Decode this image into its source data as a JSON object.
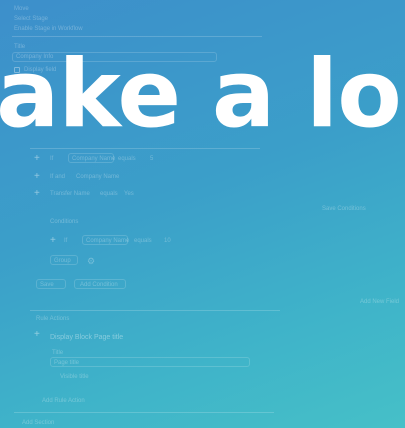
{
  "headline": "ake a lo",
  "background": {
    "top_color": "#3d8fcb",
    "bottom_color": "#46c0c8"
  },
  "ghost_ui": {
    "top_label": "Move",
    "top_sub": "Select Stage",
    "top_hint": "Enable Stage in Workflow",
    "section_label": "Title",
    "title_value": "Company Info",
    "display_label": "Display field",
    "rows": [
      {
        "op": "If",
        "a": "Company Name",
        "b": "equals",
        "c": "5"
      },
      {
        "op": "If and",
        "a": "Company Name",
        "b": "",
        "c": ""
      },
      {
        "op": "Transfer Name",
        "a": "equals",
        "b": "Yes",
        "c": ""
      }
    ],
    "right_note_1": "Save Conditions",
    "cond_group_label": "Conditions",
    "cond_row": {
      "op": "If",
      "a": "Company Name",
      "b": "equals",
      "c": "10"
    },
    "when_label": "Group",
    "bottom_add": "Add Condition",
    "bottom_when": "Save",
    "right_note_2": "Add New Field",
    "rule_header": "Rule Actions",
    "rule_title": "Display Block Page title",
    "rule_field_label": "Title",
    "rule_field_value": "Page title",
    "rule_sub": "Visible title",
    "add_rule": "Add Rule Action",
    "footer_add": "Add Section"
  }
}
